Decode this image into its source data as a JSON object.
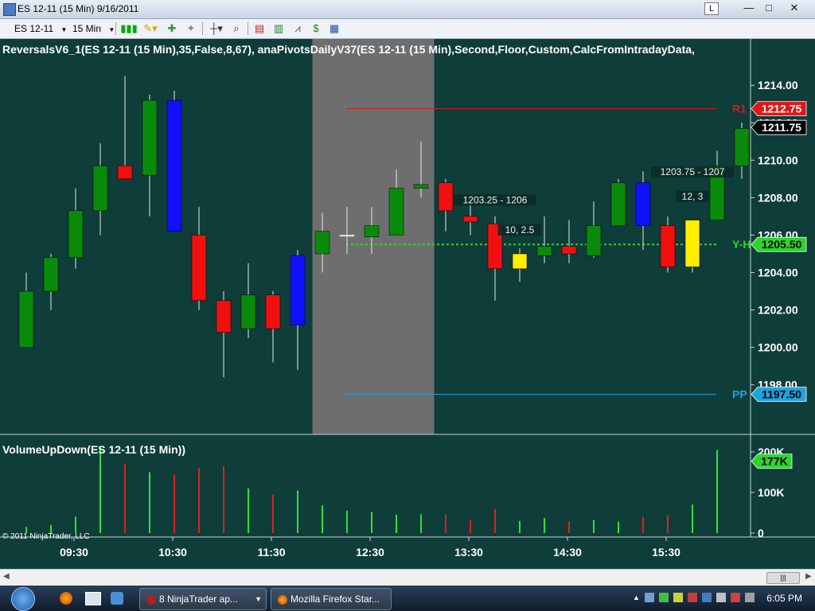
{
  "window": {
    "title": "ES 12-11 (15 Min)  9/16/2011",
    "link_label": "L",
    "minimize": "—",
    "maximize": "□",
    "close": "✕"
  },
  "toolbar": {
    "instrument": "ES 12-11",
    "interval": "15 Min"
  },
  "indicator_header": "ReversalsV6_1(ES  12-11  (15  Min),35,False,8,67),   anaPivotsDailyV37(ES  12-11  (15  Min),Second,Floor,Custom,CalcFromIntradayData,",
  "volume_header": "VolumeUpDown(ES 12-11 (15 Min))",
  "copyright": "© 2011 NinjaTrader, LLC",
  "chart_data": {
    "type": "candlestick",
    "price_axis": {
      "min": 1196.5,
      "max": 1215.2,
      "ticks": [
        "1214.00",
        "1212.00",
        "1210.00",
        "1208.00",
        "1206.00",
        "1204.00",
        "1202.00",
        "1200.00",
        "1198.00"
      ]
    },
    "time_ticks": [
      "09:30",
      "10:30",
      "11:30",
      "12:30",
      "13:30",
      "14:30",
      "15:30"
    ],
    "candles": [
      {
        "o": 1200.0,
        "h": 1204.0,
        "l": 1200.0,
        "c": 1203.0,
        "color": "#0a8a0a"
      },
      {
        "o": 1203.0,
        "h": 1205.0,
        "l": 1202.0,
        "c": 1204.8,
        "color": "#0a8a0a"
      },
      {
        "o": 1204.8,
        "h": 1208.5,
        "l": 1204.2,
        "c": 1207.3,
        "color": "#0a8a0a"
      },
      {
        "o": 1207.3,
        "h": 1210.9,
        "l": 1206.0,
        "c": 1209.7,
        "color": "#0a8a0a"
      },
      {
        "o": 1209.7,
        "h": 1214.5,
        "l": 1209.0,
        "c": 1209.0,
        "color": "#f01010"
      },
      {
        "o": 1209.2,
        "h": 1213.5,
        "l": 1207.0,
        "c": 1213.2,
        "color": "#0a8a0a"
      },
      {
        "o": 1213.2,
        "h": 1213.7,
        "l": 1206.2,
        "c": 1206.2,
        "color": "#1010ff"
      },
      {
        "o": 1206.0,
        "h": 1207.5,
        "l": 1202.0,
        "c": 1202.5,
        "color": "#f01010"
      },
      {
        "o": 1202.5,
        "h": 1203.0,
        "l": 1198.4,
        "c": 1200.8,
        "color": "#f01010"
      },
      {
        "o": 1201.0,
        "h": 1204.5,
        "l": 1200.5,
        "c": 1202.8,
        "color": "#0a8a0a"
      },
      {
        "o": 1202.8,
        "h": 1203.0,
        "l": 1199.2,
        "c": 1201.0,
        "color": "#f01010"
      },
      {
        "o": 1201.2,
        "h": 1205.2,
        "l": 1198.8,
        "c": 1204.9,
        "color": "#1010ff"
      },
      {
        "o": 1205.0,
        "h": 1207.2,
        "l": 1204.0,
        "c": 1206.2,
        "color": "#0a8a0a"
      },
      {
        "o": 1206.0,
        "h": 1207.5,
        "l": 1205.0,
        "c": 1206.0,
        "color": "#f0f0f0"
      },
      {
        "o": 1205.9,
        "h": 1207.5,
        "l": 1205.0,
        "c": 1206.5,
        "color": "#0a8a0a"
      },
      {
        "o": 1206.0,
        "h": 1209.5,
        "l": 1206.0,
        "c": 1208.5,
        "color": "#0a8a0a"
      },
      {
        "o": 1208.5,
        "h": 1211.0,
        "l": 1208.0,
        "c": 1208.7,
        "color": "#0a8a0a"
      },
      {
        "o": 1208.8,
        "h": 1209.0,
        "l": 1206.2,
        "c": 1207.3,
        "color": "#f01010"
      },
      {
        "o": 1207.0,
        "h": 1207.9,
        "l": 1206.0,
        "c": 1206.7,
        "color": "#f01010"
      },
      {
        "o": 1206.6,
        "h": 1207.0,
        "l": 1202.5,
        "c": 1204.2,
        "color": "#f01010"
      },
      {
        "o": 1205.0,
        "h": 1205.3,
        "l": 1203.5,
        "c": 1204.2,
        "color": "#ffee00"
      },
      {
        "o": 1204.9,
        "h": 1207.0,
        "l": 1204.5,
        "c": 1205.4,
        "color": "#0a8a0a"
      },
      {
        "o": 1205.4,
        "h": 1206.8,
        "l": 1204.5,
        "c": 1205.0,
        "color": "#f01010"
      },
      {
        "o": 1204.9,
        "h": 1207.8,
        "l": 1204.8,
        "c": 1206.5,
        "color": "#0a8a0a"
      },
      {
        "o": 1206.5,
        "h": 1209.0,
        "l": 1206.5,
        "c": 1208.8,
        "color": "#0a8a0a"
      },
      {
        "o": 1208.8,
        "h": 1209.4,
        "l": 1205.2,
        "c": 1206.5,
        "color": "#1010ff"
      },
      {
        "o": 1206.5,
        "h": 1207.0,
        "l": 1204.0,
        "c": 1204.3,
        "color": "#f01010"
      },
      {
        "o": 1206.8,
        "h": 1206.8,
        "l": 1204.0,
        "c": 1204.3,
        "color": "#ffee00"
      },
      {
        "o": 1206.8,
        "h": 1210.5,
        "l": 1206.8,
        "c": 1209.7,
        "color": "#0a8a0a"
      },
      {
        "o": 1209.7,
        "h": 1212.0,
        "l": 1209.0,
        "c": 1211.7,
        "color": "#0a8a0a"
      }
    ],
    "shaded_session_bars": [
      12,
      16
    ],
    "levels": [
      {
        "label": "R1",
        "value": 1212.75,
        "price_tag": "1212.75",
        "color": "#e01818"
      },
      {
        "label": "Y-H",
        "value": 1205.5,
        "price_tag": "1205.50",
        "color": "#2ad62a"
      },
      {
        "label": "PP",
        "value": 1197.5,
        "price_tag": "1197.50",
        "color": "#1ea3e0"
      }
    ],
    "last_price": {
      "value": 1211.75,
      "label": "1211.75"
    },
    "annotations": [
      {
        "text": "1203.25 - 1206",
        "bar": 19,
        "price": 1207.7
      },
      {
        "text": "10, 2.5",
        "bar": 20,
        "price": 1206.1
      },
      {
        "text": "1203.75 - 1207",
        "bar": 27,
        "price": 1209.2
      },
      {
        "text": "12, 3",
        "bar": 27,
        "price": 1207.9
      }
    ],
    "volume": {
      "ticks": [
        "200K",
        "100K",
        "0"
      ],
      "max": 200,
      "last_tag": "177K",
      "bars": [
        {
          "v": 15,
          "c": "#33e033"
        },
        {
          "v": 20,
          "c": "#33e033"
        },
        {
          "v": 40,
          "c": "#33e033"
        },
        {
          "v": 210,
          "c": "#33e033"
        },
        {
          "v": 170,
          "c": "#e02020"
        },
        {
          "v": 150,
          "c": "#33e033"
        },
        {
          "v": 145,
          "c": "#e02020"
        },
        {
          "v": 160,
          "c": "#e02020"
        },
        {
          "v": 165,
          "c": "#e02020"
        },
        {
          "v": 110,
          "c": "#33e033"
        },
        {
          "v": 95,
          "c": "#e02020"
        },
        {
          "v": 105,
          "c": "#33e033"
        },
        {
          "v": 68,
          "c": "#33e033"
        },
        {
          "v": 55,
          "c": "#33e033"
        },
        {
          "v": 52,
          "c": "#33e033"
        },
        {
          "v": 45,
          "c": "#33e033"
        },
        {
          "v": 46,
          "c": "#33e033"
        },
        {
          "v": 46,
          "c": "#e02020"
        },
        {
          "v": 32,
          "c": "#e02020"
        },
        {
          "v": 60,
          "c": "#e02020"
        },
        {
          "v": 30,
          "c": "#33e033"
        },
        {
          "v": 37,
          "c": "#33e033"
        },
        {
          "v": 28,
          "c": "#e02020"
        },
        {
          "v": 32,
          "c": "#33e033"
        },
        {
          "v": 28,
          "c": "#33e033"
        },
        {
          "v": 40,
          "c": "#e02020"
        },
        {
          "v": 44,
          "c": "#e02020"
        },
        {
          "v": 70,
          "c": "#33e033"
        },
        {
          "v": 205,
          "c": "#33e033"
        }
      ]
    }
  },
  "taskbar": {
    "apps": [
      {
        "label": "8  NinjaTrader ap...",
        "icon": "ninjatrader-icon"
      },
      {
        "label": "Mozilla Firefox Star...",
        "icon": "firefox-icon"
      }
    ],
    "clock": "6:05 PM"
  }
}
